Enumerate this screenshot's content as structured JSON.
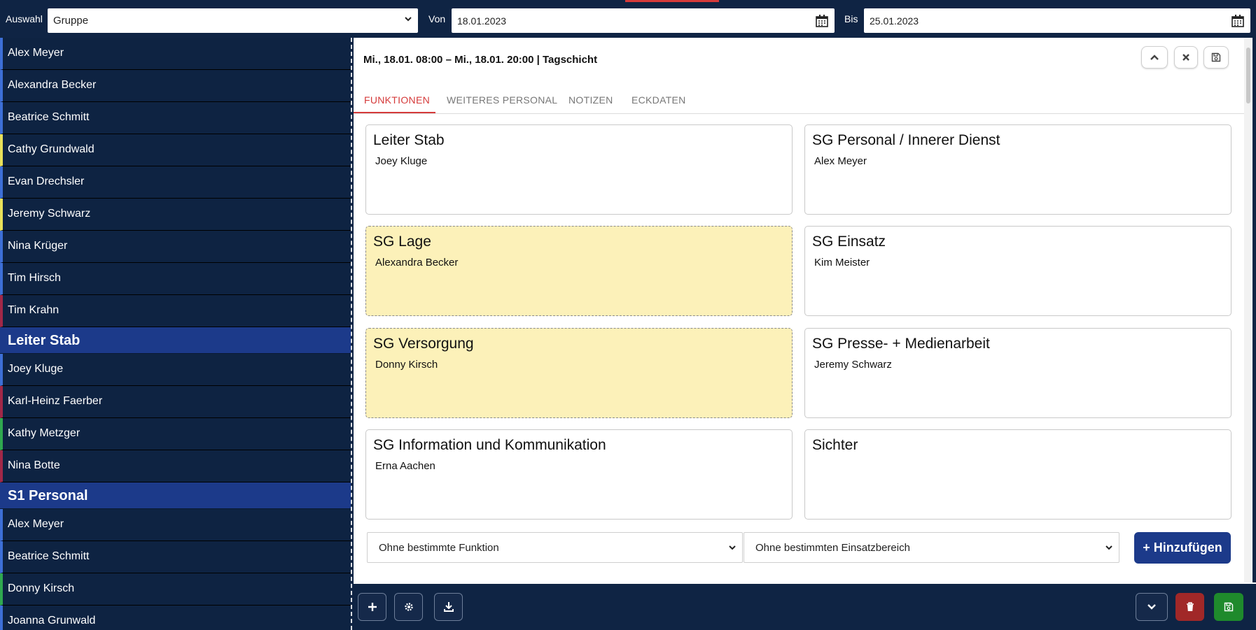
{
  "topbar": {
    "auswahl_label": "Auswahl",
    "group_value": "Gruppe",
    "von_label": "Von",
    "von_value": "18.01.2023",
    "bis_label": "Bis",
    "bis_value": "25.01.2023"
  },
  "sidebar": {
    "rows_a": [
      {
        "name": "Alex Meyer",
        "color": "#3d6fd6"
      },
      {
        "name": "Alexandra Becker",
        "color": "#3d6fd6"
      },
      {
        "name": "Beatrice Schmitt",
        "color": "#3d6fd6"
      },
      {
        "name": "Cathy Grundwald",
        "color": "#e8e05a"
      },
      {
        "name": "Evan Drechsler",
        "color": "#3d6fd6"
      },
      {
        "name": "Jeremy Schwarz",
        "color": "#e8e05a"
      },
      {
        "name": "Nina Krüger",
        "color": "#3d6fd6"
      },
      {
        "name": "Tim Hirsch",
        "color": "#3d6fd6"
      },
      {
        "name": "Tim Krahn",
        "color": "#a12848"
      }
    ],
    "group_b": "Leiter Stab",
    "rows_b": [
      {
        "name": "Joey Kluge",
        "color": "#3d6fd6"
      },
      {
        "name": "Karl-Heinz Faerber",
        "color": "#a12848"
      },
      {
        "name": "Kathy Metzger",
        "color": "#2fa84f"
      },
      {
        "name": "Nina Botte",
        "color": "#a12848"
      }
    ],
    "group_c": "S1 Personal",
    "rows_c": [
      {
        "name": "Alex Meyer",
        "color": "#3d6fd6"
      },
      {
        "name": "Beatrice Schmitt",
        "color": "#3d6fd6"
      },
      {
        "name": "Donny Kirsch",
        "color": "#2fa84f"
      },
      {
        "name": "Joanna Grunwald",
        "color": "#3d6fd6"
      }
    ]
  },
  "main": {
    "shift_title": "Mi., 18.01. 08:00 – Mi., 18.01. 20:00 | Tagschicht",
    "tabs": [
      "FUNKTIONEN",
      "WEITERES PERSONAL",
      "NOTIZEN",
      "ECKDATEN"
    ],
    "cards": [
      {
        "title": "Leiter Stab",
        "person": "Joey Kluge",
        "highlight": false
      },
      {
        "title": "SG Personal / Innerer Dienst",
        "person": "Alex Meyer",
        "highlight": false
      },
      {
        "title": "SG Lage",
        "person": "Alexandra Becker",
        "highlight": true
      },
      {
        "title": "SG Einsatz",
        "person": "Kim Meister",
        "highlight": false
      },
      {
        "title": "SG Versorgung",
        "person": "Donny Kirsch",
        "highlight": true
      },
      {
        "title": "SG Presse- + Medienarbeit",
        "person": "Jeremy Schwarz",
        "highlight": false
      },
      {
        "title": "SG Information und Kommunikation",
        "person": "Erna Aachen",
        "highlight": false
      },
      {
        "title": "Sichter",
        "person": "",
        "highlight": false
      }
    ],
    "function_select": "Ohne bestimmte Funktion",
    "area_select": "Ohne bestimmten Einsatzbereich",
    "add_label": "+ Hinzufügen"
  },
  "colors": {
    "navy": "#0f2444",
    "group_blue": "#1c3a8a",
    "accent_red": "#d53a3a",
    "highlight_yellow": "#fcf1b9"
  }
}
